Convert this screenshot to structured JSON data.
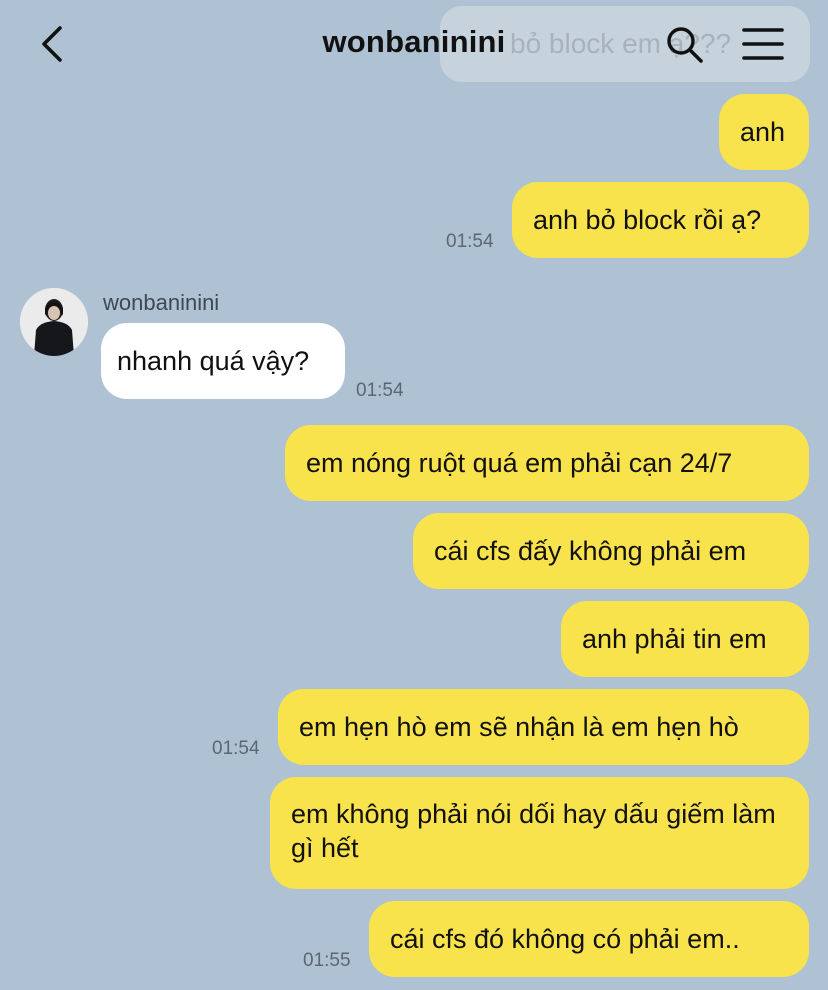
{
  "header": {
    "title": "wonbaninini",
    "ghost_text": "bỏ block em ạ???"
  },
  "messages": [
    {
      "text": "anh"
    },
    {
      "text": "anh bỏ block rồi ạ?",
      "time": "01:54"
    },
    {
      "sender": "wonbaninini",
      "text": "nhanh quá vậy?",
      "time": "01:54"
    },
    {
      "text": "em nóng ruột quá em phải cạn 24/7"
    },
    {
      "text": "cái cfs đấy không phải em"
    },
    {
      "text": "anh phải tin em"
    },
    {
      "text": "em hẹn hò em sẽ nhận là em hẹn hò",
      "time": "01:54"
    },
    {
      "text": "em không phải nói dối hay dấu giếm làm gì hết"
    },
    {
      "text": "cái cfs đó không có phải em..",
      "time": "01:55"
    }
  ],
  "colors": {
    "background": "#afc2d3",
    "my_bubble": "#f9e34c",
    "their_bubble": "#ffffff"
  }
}
